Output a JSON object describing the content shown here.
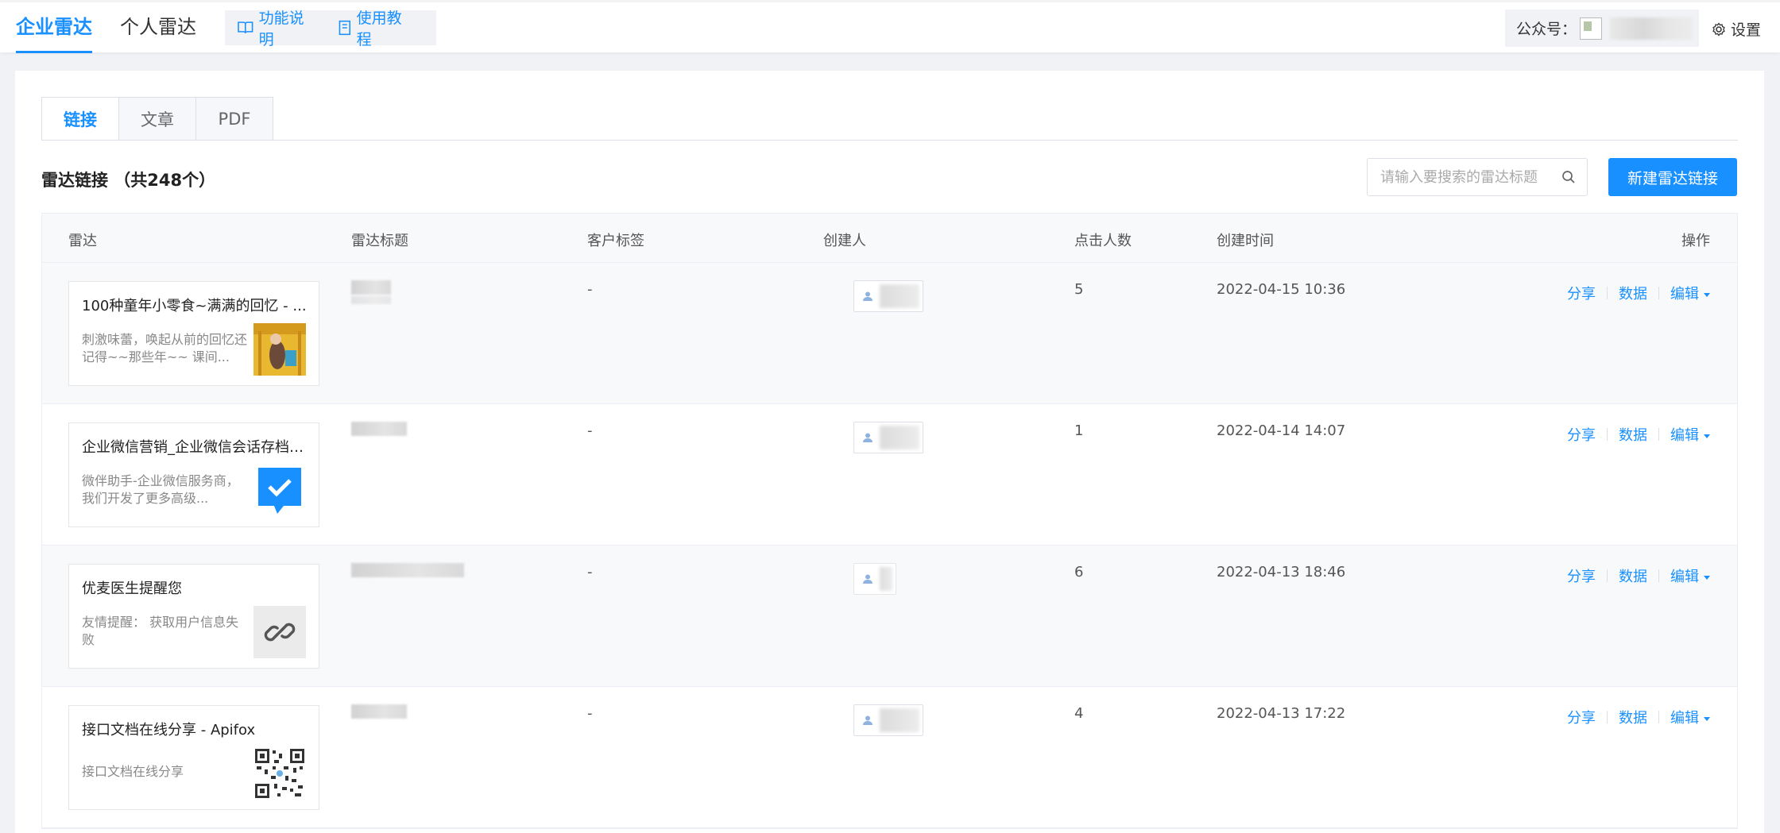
{
  "header": {
    "nav_main": "企业雷达",
    "nav_second": "个人雷达",
    "help_items": [
      {
        "label": "功能说明",
        "icon": "book-icon"
      },
      {
        "label": "使用教程",
        "icon": "document-icon"
      }
    ],
    "account_label": "公众号：",
    "settings_label": "设置"
  },
  "tabs": [
    {
      "label": "链接",
      "active": true
    },
    {
      "label": "文章",
      "active": false
    },
    {
      "label": "PDF",
      "active": false
    }
  ],
  "section": {
    "title": "雷达链接 （共248个）",
    "search_placeholder": "请输入要搜索的雷达标题",
    "new_button": "新建雷达链接"
  },
  "table": {
    "columns": [
      "雷达",
      "雷达标题",
      "客户标签",
      "创建人",
      "点击人数",
      "创建时间",
      "操作"
    ],
    "rows": [
      {
        "radar_title": "100种童年小零食~满满的回忆 - ...",
        "radar_desc": "刺激味蕾，唤起从前的回忆还记得~~那些年~~ 课间...",
        "thumb": "photo",
        "tag": "-",
        "clicks": "5",
        "created": "2022-04-15 10:36"
      },
      {
        "radar_title": "企业微信营销_企业微信会话存档_...",
        "radar_desc": "微伴助手-企业微信服务商，我们开发了更多高级...",
        "thumb": "check-chat-icon",
        "tag": "-",
        "clicks": "1",
        "created": "2022-04-14 14:07"
      },
      {
        "radar_title": "优麦医生提醒您",
        "radar_desc": "友情提醒： 获取用户信息失败",
        "thumb": "link-icon",
        "tag": "-",
        "clicks": "6",
        "created": "2022-04-13 18:46"
      },
      {
        "radar_title": "接口文档在线分享 - Apifox",
        "radar_desc": "接口文档在线分享",
        "thumb": "qr-code",
        "tag": "-",
        "clicks": "4",
        "created": "2022-04-13 17:22"
      }
    ],
    "ops": {
      "share": "分享",
      "data": "数据",
      "edit": "编辑"
    }
  },
  "colors": {
    "accent": "#1890ff",
    "background": "#f0f2f5"
  }
}
